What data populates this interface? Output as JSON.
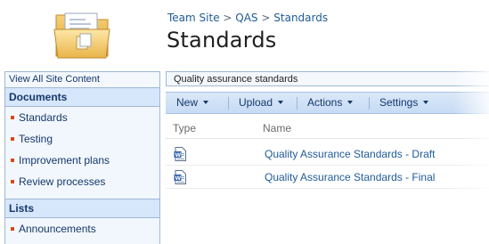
{
  "breadcrumb": {
    "site": "Team Site",
    "sep1": ">",
    "library": "QAS",
    "sep2": ">",
    "current": "Standards"
  },
  "page_title": "Standards",
  "leftnav": {
    "view_all": "View All Site Content",
    "documents_header": "Documents",
    "documents": [
      {
        "label": "Standards"
      },
      {
        "label": "Testing"
      },
      {
        "label": "Improvement plans"
      },
      {
        "label": "Review processes"
      }
    ],
    "lists_header": "Lists",
    "lists": [
      {
        "label": "Announcements"
      }
    ]
  },
  "description": "Quality assurance standards",
  "toolbar": {
    "new": "New",
    "upload": "Upload",
    "actions": "Actions",
    "settings": "Settings"
  },
  "columns": {
    "type": "Type",
    "name": "Name"
  },
  "rows": [
    {
      "icon": "word-document-icon",
      "name": "Quality Assurance Standards - Draft"
    },
    {
      "icon": "word-document-icon",
      "name": "Quality Assurance Standards - Final"
    }
  ],
  "colors": {
    "link": "#1f5b98",
    "nav_text": "#14386b",
    "bullet": "#d64b1c",
    "header_bg": "#d6e6fb"
  }
}
